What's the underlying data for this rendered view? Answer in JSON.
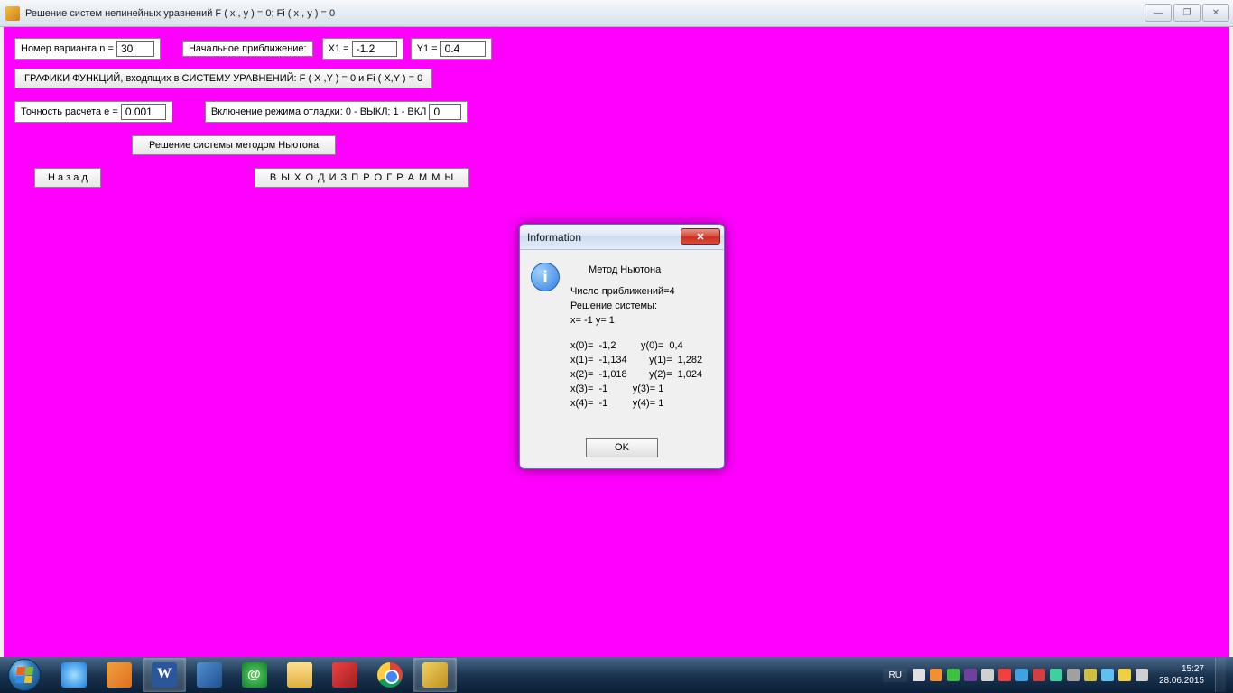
{
  "window": {
    "title": "Решение систем нелинейных уравнений  F ( x , y ) = 0;   Fi ( x , y ) = 0",
    "minimize": "—",
    "maximize": "❐",
    "close": "✕"
  },
  "form": {
    "variant_label": "Номер варианта  n =",
    "variant_value": "30",
    "initial_label": "Начальное приближение:",
    "x1_label": "X1 =",
    "x1_value": "-1.2",
    "y1_label": "Y1 =",
    "y1_value": "0.4",
    "graphs_button": "ГРАФИКИ ФУНКЦИЙ, входящих в  СИСТЕМУ  УРАВНЕНИЙ:  F ( X ,Y ) = 0  и  Fi ( X,Y ) = 0",
    "precision_label": "Точность расчета  e =",
    "precision_value": "0.001",
    "debug_label": "Включение режима отладки: 0 - ВЫКЛ;  1 - ВКЛ",
    "debug_value": "0",
    "solve_button": "Решение системы методом Ньютона",
    "back_button": "Н а з а д",
    "exit_button": "В Ы Х О Д     И З     П Р О Г Р А М М Ы"
  },
  "dialog": {
    "title": "Information",
    "close": "✕",
    "method_title": "Метод Ньютона",
    "line_iter": "Число приближений=4",
    "line_sol_header": "Решение системы:",
    "line_sol": "x=  -1            y=  1",
    "iterations": "x(0)=  -1,2         y(0)=  0,4\nx(1)=  -1,134        y(1)=  1,282\nx(2)=  -1,018        y(2)=  1,024\nx(3)=  -1         y(3)= 1\nx(4)=  -1         y(4)= 1",
    "ok": "OK"
  },
  "taskbar": {
    "lang": "RU",
    "time": "15:27",
    "date": "28.06.2015"
  }
}
